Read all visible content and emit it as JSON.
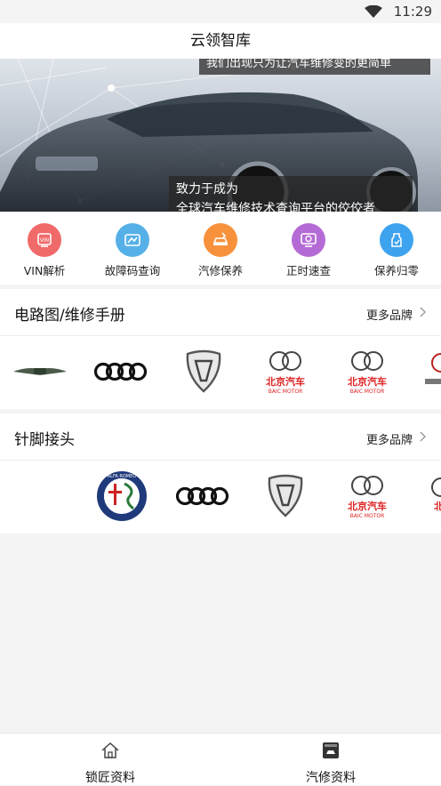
{
  "status_bar": {
    "time": "11:29"
  },
  "title_bar": {
    "title": "云领智库"
  },
  "banner": {
    "top_text": "我们出现只为让汽车维修变的更简单",
    "line1": "致力于成为",
    "line2": "全球汽车维修技术查询平台的佼佼者"
  },
  "quick_actions": [
    {
      "label": "VIN解析",
      "icon": "vin-icon",
      "color": "#f06a6a"
    },
    {
      "label": "故障码查询",
      "icon": "fault-code-icon",
      "color": "#55b0e8"
    },
    {
      "label": "汽修保养",
      "icon": "car-maintenance-icon",
      "color": "#f7913b"
    },
    {
      "label": "正时速查",
      "icon": "timing-icon",
      "color": "#b56bd6"
    },
    {
      "label": "保养归零",
      "icon": "maintenance-reset-icon",
      "color": "#3ea3ef"
    }
  ],
  "sections": [
    {
      "title": "电路图/维修手册",
      "more": "更多品牌"
    },
    {
      "title": "针脚接头",
      "more": "更多品牌"
    }
  ],
  "brands": {
    "baic_cn": "北京汽车",
    "baic_en": "BAIC MOTOR",
    "alfa": "ALFA ROMEO"
  },
  "tab_bar": [
    {
      "label": "锁匠资料",
      "icon": "home-icon"
    },
    {
      "label": "汽修资料",
      "icon": "car-manual-icon"
    }
  ]
}
